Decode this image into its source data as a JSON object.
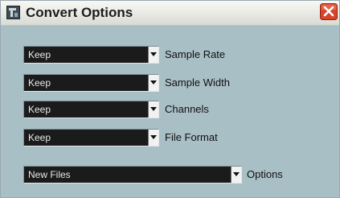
{
  "window": {
    "title": "Convert Options",
    "app_icon": "app-logo-icon",
    "close_icon": "close-icon",
    "colors": {
      "client_bg": "#a9bfc6",
      "combo_bg": "#1b1b1b",
      "close_red": "#d9432a"
    }
  },
  "options": [
    {
      "value": "Keep",
      "label": "Sample Rate"
    },
    {
      "value": "Keep",
      "label": "Sample Width"
    },
    {
      "value": "Keep",
      "label": "Channels"
    },
    {
      "value": "Keep",
      "label": "File Format"
    },
    {
      "value": "New Files",
      "label": "Options"
    }
  ]
}
